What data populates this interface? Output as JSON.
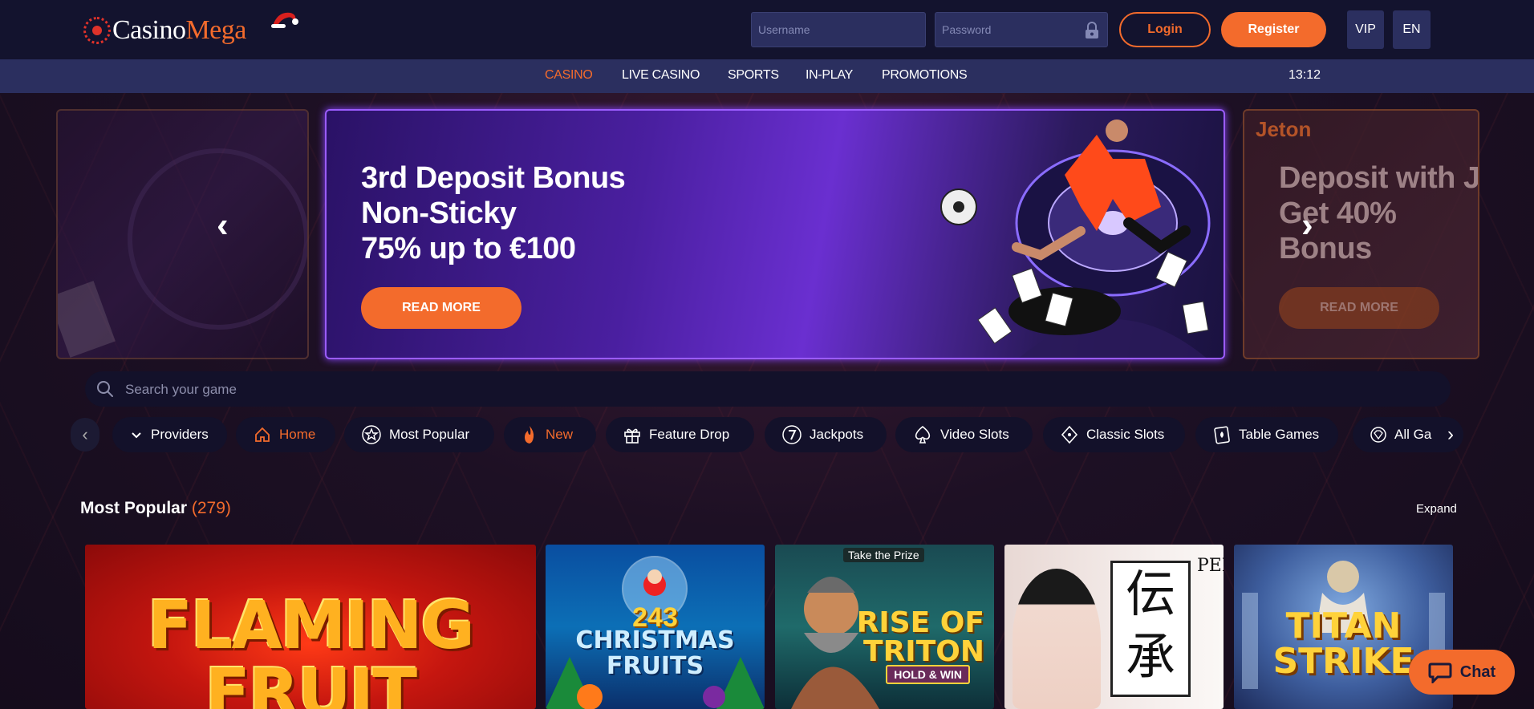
{
  "header": {
    "logo_part1": "Casino",
    "logo_part2": "Mega",
    "username_placeholder": "Username",
    "password_placeholder": "Password",
    "login_label": "Login",
    "register_label": "Register",
    "vip_label": "VIP",
    "language_label": "EN"
  },
  "nav": {
    "items": [
      "CASINO",
      "LIVE CASINO",
      "SPORTS",
      "IN-PLAY",
      "PROMOTIONS"
    ],
    "active": "CASINO",
    "time": "13:12"
  },
  "carousel": {
    "main": {
      "title_lines": [
        "3rd Deposit Bonus",
        "Non-Sticky",
        "75% up to €100"
      ],
      "button_label": "READ MORE"
    },
    "next": {
      "brand": "Jeton",
      "title_lines": [
        "Deposit with Je",
        "Get 40%",
        "Bonus"
      ],
      "button_label": "READ MORE"
    }
  },
  "search": {
    "placeholder": "Search your game"
  },
  "categories": [
    {
      "label": "Providers",
      "icon": "chevron-down-icon"
    },
    {
      "label": "Home",
      "icon": "home-icon",
      "active": true
    },
    {
      "label": "Most Popular",
      "icon": "star-icon"
    },
    {
      "label": "New",
      "icon": "flame-icon"
    },
    {
      "label": "Feature Drop",
      "icon": "gift-icon"
    },
    {
      "label": "Jackpots",
      "icon": "seven-icon"
    },
    {
      "label": "Video Slots",
      "icon": "spade-icon"
    },
    {
      "label": "Classic Slots",
      "icon": "diamond-icon"
    },
    {
      "label": "Table Games",
      "icon": "card-icon"
    },
    {
      "label": "All Ga",
      "icon": "gem-icon"
    }
  ],
  "section": {
    "title": "Most Popular",
    "count": "(279)",
    "expand_label": "Expand"
  },
  "games": [
    {
      "name": "FLAMING FRUIT"
    },
    {
      "name": "243 CHRISTMAS FRUITS",
      "number": "243",
      "words": "CHRISTMAS FRUITS"
    },
    {
      "name": "RISE OF TRITON",
      "badge": "Take the Prize",
      "subtitle": "HOLD & WIN"
    },
    {
      "name": "PENGHO",
      "kanji": "伝承",
      "letters": "PENGHO"
    },
    {
      "name": "TITAN STRIKE"
    }
  ],
  "chat": {
    "label": "Chat"
  },
  "colors": {
    "accent": "#f36b2c",
    "header_bg": "#13132e",
    "nav_bg": "#2b2f5f",
    "slide_border": "#9b5cff"
  }
}
